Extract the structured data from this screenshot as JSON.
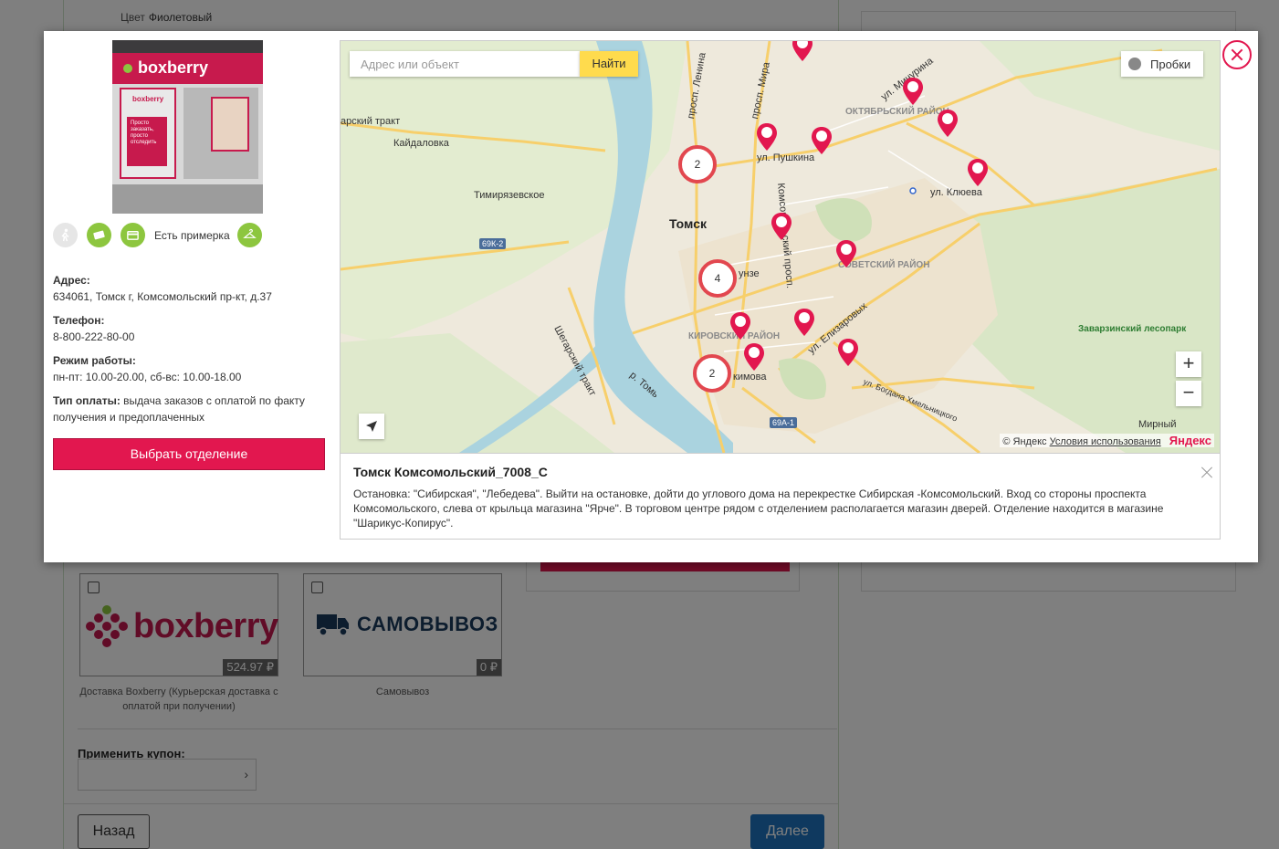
{
  "background": {
    "color_key": "Цвет",
    "color_value": "Фиолетовый",
    "shipping_options": [
      {
        "logo_text": "boxberry",
        "price": "524.97 ₽",
        "caption": "Доставка Boxberry (Курьерская доставка с оплатой при получении)"
      },
      {
        "logo_text": "САМОВЫВОЗ",
        "price": "0 ₽",
        "caption": "Самовывоз"
      }
    ],
    "coupon_label": "Применить купон:",
    "coupon_arrow": "›",
    "back_button": "Назад",
    "next_button": "Далее"
  },
  "modal": {
    "photo": {
      "sign_text": "boxberry",
      "door_logo": "boxberry",
      "door_sign_text": "Просто заказать, просто отследить"
    },
    "features": {
      "fitting_text": "Есть примерка"
    },
    "info": {
      "address_label": "Адрес:",
      "address_value": "634061, Томск г, Комсомольский пр-кт, д.37",
      "phone_label": "Телефон:",
      "phone_value": "8-800-222-80-00",
      "hours_label": "Режим работы:",
      "hours_value": "пн-пт: 10.00-20.00, сб-вс: 10.00-18.00",
      "payment_label": "Тип оплаты:",
      "payment_value": "выдача заказов с оплатой по факту получения и предоплаченных"
    },
    "choose_button": "Выбрать отделение"
  },
  "map": {
    "search_placeholder": "Адрес или объект",
    "find_button": "Найти",
    "traffic_button": "Пробки",
    "zoom_in": "+",
    "zoom_out": "−",
    "labels": {
      "tract": "арский тракт",
      "kaydalovka": "Кайдаловка",
      "timiryazevskoe": "Тимирязевское",
      "tomsk": "Томск",
      "shegarsky": "Шегарский тракт",
      "tom_river": "р. Томь",
      "prosp_lenina": "просп. Ленина",
      "prosp_mira": "просп. Мира",
      "michurina": "ул. Мичурина",
      "oktyabrsky": "ОКТЯБРЬСКИЙ РАЙОН",
      "pushkina": "ул. Пушкина",
      "klyueva": "ул. Клюева",
      "komsomolsky": "Комсомольский просп.",
      "sovetsky": "СОВЕТСКИЙ РАЙОН",
      "frunze": "унзе",
      "kirovsky": "КИРОВСКИЙ РАЙОН",
      "elizarovyh": "ул. Елизаровых",
      "bogdana": "ул. Богдана Хмельницкого",
      "zavarzinsky": "Заварзинский лесопарк",
      "mirny": "Мирный",
      "akimova": "кимова"
    },
    "road_shields": [
      "69К-2",
      "69А-1"
    ],
    "clusters": [
      "2",
      "4",
      "2"
    ],
    "copyright": "© Яндекс",
    "terms": "Условия использования",
    "brand": "Яндекс"
  },
  "balloon": {
    "title": "Томск Комсомольский_7008_С",
    "text": "Остановка: \"Сибирская\", \"Лебедева\". Выйти на остановке, дойти до углового дома на перекрестке Сибирская -Комсомольский. Вход со стороны проспекта Комсомольского, слева от крыльца магазина \"Ярче\". В торговом центре рядом с отделением располагается магазин дверей. Отделение находится в магазине \"Шарикус-Копирус\"."
  },
  "colors": {
    "accent": "#e2174f",
    "green": "#8dc63f",
    "primary_blue": "#1e73be"
  }
}
